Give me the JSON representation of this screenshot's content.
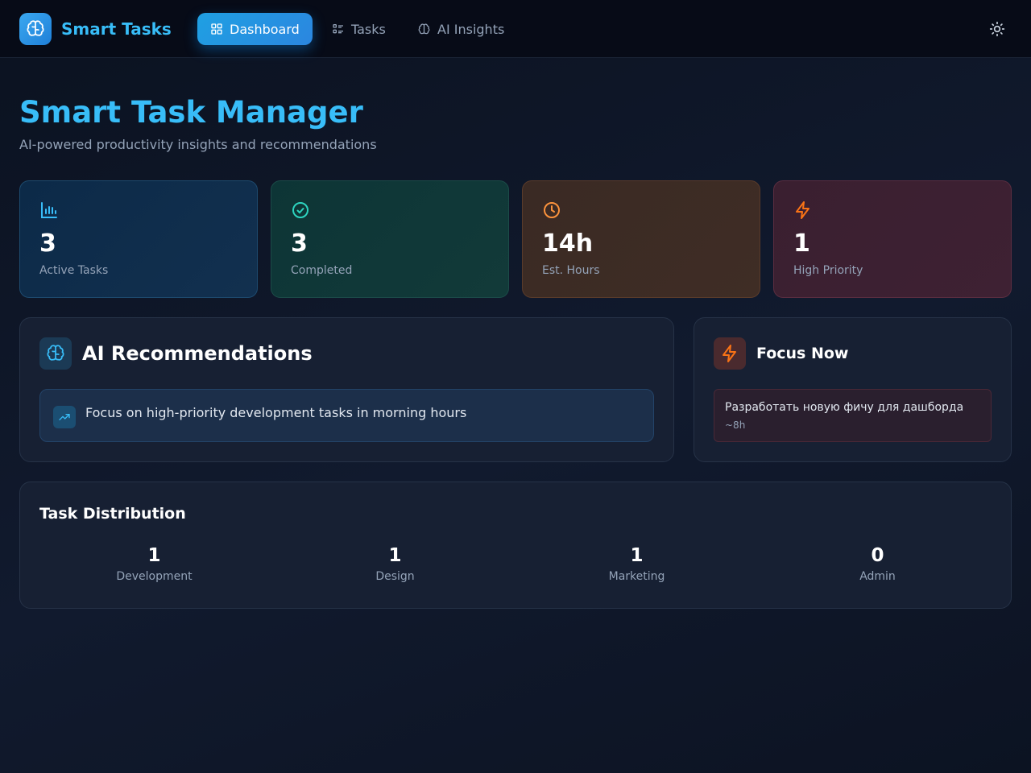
{
  "nav": {
    "brand": "Smart Tasks",
    "items": [
      {
        "label": "Dashboard",
        "icon": "grid-icon",
        "active": true
      },
      {
        "label": "Tasks",
        "icon": "list-icon",
        "active": false
      },
      {
        "label": "AI Insights",
        "icon": "brain-icon",
        "active": false
      }
    ],
    "theme_toggle_icon": "sun-icon"
  },
  "header": {
    "title": "Smart Task Manager",
    "subtitle": "AI-powered productivity insights and recommendations"
  },
  "stats": [
    {
      "value": "3",
      "label": "Active Tasks",
      "icon": "bar-chart-icon",
      "color": "#38bdf8"
    },
    {
      "value": "3",
      "label": "Completed",
      "icon": "check-circle-icon",
      "color": "#2dd4bf"
    },
    {
      "value": "14h",
      "label": "Est. Hours",
      "icon": "clock-icon",
      "color": "#fb923c"
    },
    {
      "value": "1",
      "label": "High Priority",
      "icon": "lightning-icon",
      "color": "#f97316"
    }
  ],
  "recommendations": {
    "title": "AI Recommendations",
    "items": [
      {
        "text": "Focus on high-priority development tasks in morning hours",
        "icon": "trending-up-icon"
      }
    ]
  },
  "focus": {
    "title": "Focus Now",
    "task": {
      "title": "Разработать новую фичу для дашборда",
      "estimate": "~8h"
    }
  },
  "distribution": {
    "title": "Task Distribution",
    "categories": [
      {
        "value": "1",
        "label": "Development"
      },
      {
        "value": "1",
        "label": "Design"
      },
      {
        "value": "1",
        "label": "Marketing"
      },
      {
        "value": "0",
        "label": "Admin"
      }
    ]
  },
  "colors": {
    "accent": "#38bdf8",
    "nav_active": "#2b86e0",
    "background": "#0b1220"
  }
}
